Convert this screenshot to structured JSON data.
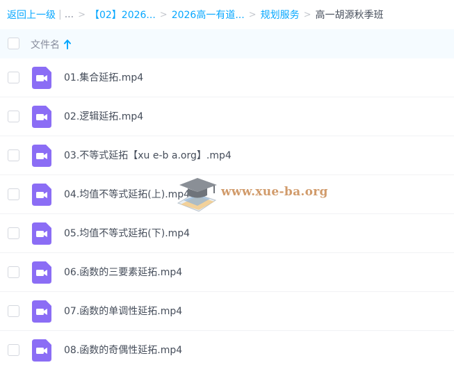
{
  "breadcrumb": {
    "back_label": "返回上一级",
    "divider": "|",
    "ellipsis": "...",
    "sep": ">",
    "items": [
      "【02】2026...",
      "2026高一有道...",
      "规划服务"
    ],
    "current": "高一胡源秋季班"
  },
  "header": {
    "name_column": "文件名",
    "sort_icon": "arrow-up-icon"
  },
  "files": [
    {
      "name": "01.集合延拓.mp4",
      "icon": "video-file-icon"
    },
    {
      "name": "02.逻辑延拓.mp4",
      "icon": "video-file-icon"
    },
    {
      "name": "03.不等式延拓【xu e-b a.org】.mp4",
      "icon": "video-file-icon"
    },
    {
      "name": "04.均值不等式延拓(上).mp4",
      "icon": "video-file-icon"
    },
    {
      "name": "05.均值不等式延拓(下).mp4",
      "icon": "video-file-icon"
    },
    {
      "name": "06.函数的三要素延拓.mp4",
      "icon": "video-file-icon"
    },
    {
      "name": "07.函数的单调性延拓.mp4",
      "icon": "video-file-icon"
    },
    {
      "name": "08.函数的奇偶性延拓.mp4",
      "icon": "video-file-icon"
    }
  ],
  "watermark": {
    "text": "www.xue-ba.org"
  },
  "colors": {
    "link": "#06a7ff",
    "text": "#454d5a",
    "header_bg": "#f5fbff",
    "video_icon": "#8b6df5"
  }
}
